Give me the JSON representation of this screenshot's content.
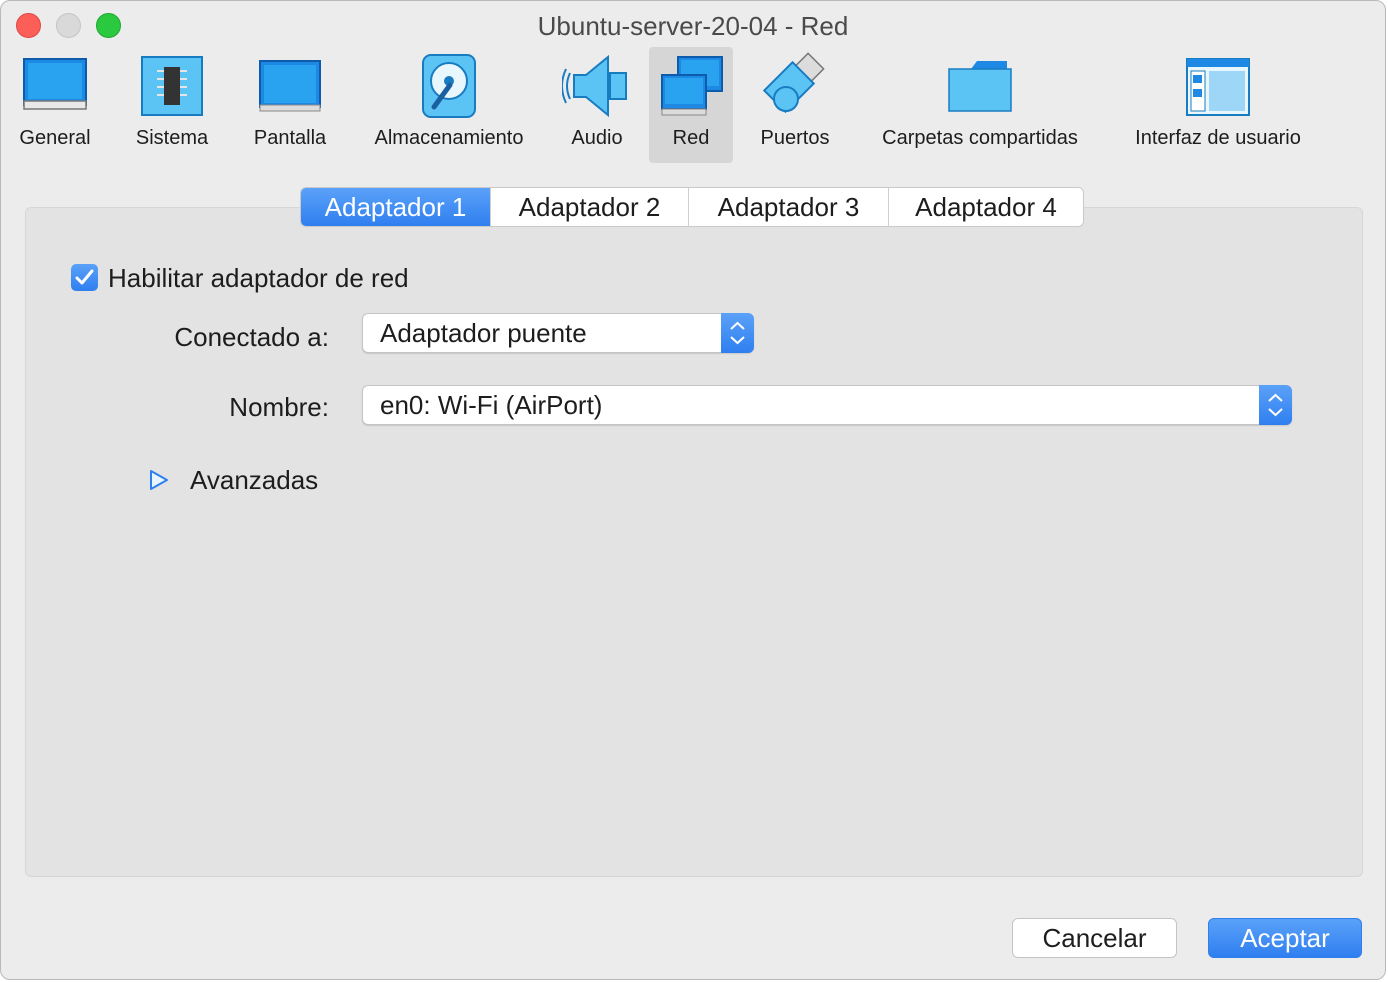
{
  "window": {
    "title": "Ubuntu-server-20-04 - Red"
  },
  "toolbar": {
    "items": [
      {
        "label": "General",
        "icon": "monitor-icon",
        "selected": false
      },
      {
        "label": "Sistema",
        "icon": "chip-icon",
        "selected": false
      },
      {
        "label": "Pantalla",
        "icon": "display-icon",
        "selected": false
      },
      {
        "label": "Almacenamiento",
        "icon": "hard-disk-icon",
        "selected": false
      },
      {
        "label": "Audio",
        "icon": "speaker-icon",
        "selected": false
      },
      {
        "label": "Red",
        "icon": "network-icon",
        "selected": true
      },
      {
        "label": "Puertos",
        "icon": "port-plug-icon",
        "selected": false
      },
      {
        "label": "Carpetas compartidas",
        "icon": "folder-icon",
        "selected": false
      },
      {
        "label": "Interfaz de usuario",
        "icon": "window-layout-icon",
        "selected": false
      }
    ]
  },
  "tabs": [
    {
      "label": "Adaptador 1",
      "active": true
    },
    {
      "label": "Adaptador 2",
      "active": false
    },
    {
      "label": "Adaptador 3",
      "active": false
    },
    {
      "label": "Adaptador 4",
      "active": false
    }
  ],
  "adapter": {
    "enable_label": "Habilitar adaptador de red",
    "enabled": true,
    "attached_label": "Conectado a:",
    "attached_value": "Adaptador puente",
    "name_label": "Nombre:",
    "name_value": "en0: Wi-Fi (AirPort)",
    "advanced_label": "Avanzadas"
  },
  "buttons": {
    "cancel": "Cancelar",
    "accept": "Aceptar"
  },
  "colors": {
    "accent": "#2f7ff0",
    "window_bg": "#ececec",
    "panel_bg": "#e3e3e3"
  }
}
